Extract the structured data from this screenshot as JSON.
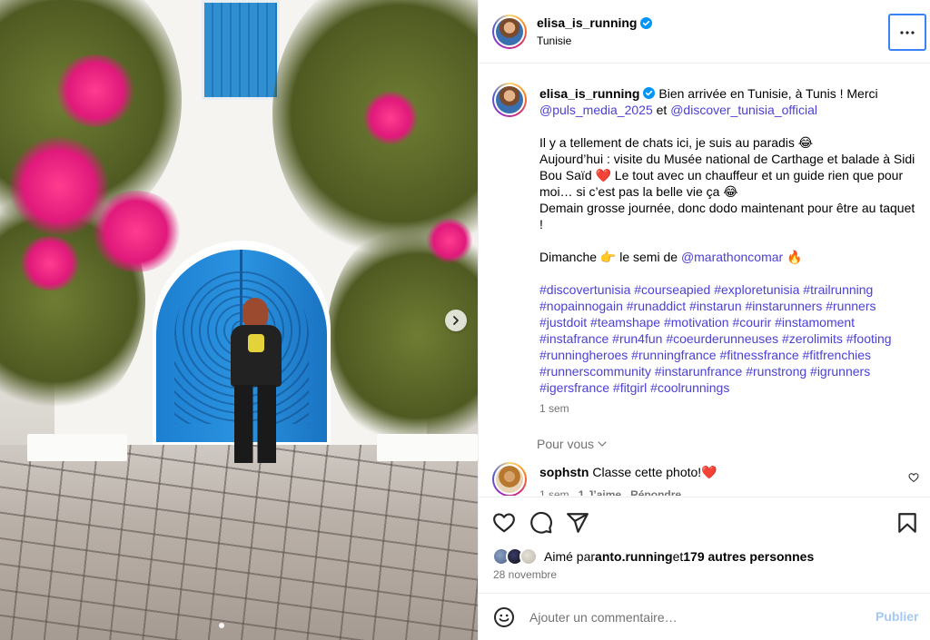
{
  "post": {
    "username": "elisa_is_running",
    "location": "Tunisie",
    "verified_icon": "verified-badge-icon",
    "more_icon": "more-options-icon"
  },
  "caption": {
    "username": "elisa_is_running",
    "intro": " Bien arrivée en Tunisie, à Tunis ! Merci ",
    "mention1": "@puls_media_2025",
    "and": " et ",
    "mention2": "@discover_tunisia_official",
    "line1": "Il y a tellement de chats ici, je suis au paradis 😂",
    "line2": "Aujourd’hui : visite du Musée national de Carthage et balade à Sidi Bou Saïd ❤️ Le tout avec un chauffeur et un guide rien que pour moi… si c’est pas la belle vie ça 😂",
    "line3": "Demain grosse journée, donc dodo maintenant pour être au taquet !",
    "sunday_prefix": "Dimanche 👉 le semi de ",
    "sunday_mention": "@marathoncomar",
    "sunday_suffix": " 🔥",
    "hashtags": "#discovertunisia #courseapied #exploretunisia #trailrunning #nopainnogain #runaddict #instarun #instarunners #runners #justdoit #teamshape #motivation #courir #instamoment #instafrance #run4fun #coeurderunneuses  #zerolimits #footing #runningheroes #runningfrance #fitnessfrance #fitfrenchies #runnerscommunity #instarunfrance #runstrong #igrunners #igersfrance #fitgirl #coolrunnings",
    "time_ago": "1 sem"
  },
  "translation": {
    "label": "Pour vous"
  },
  "comment": {
    "username": "sophstn",
    "text": " Classe cette photo!❤️",
    "time_ago": "1 sem",
    "likes": "1 J’aime",
    "reply": "Répondre"
  },
  "likes": {
    "prefix": "Aimé par ",
    "first_user": "anto.running",
    "middle": " et ",
    "others": "179 autres personnes",
    "date": "28 novembre"
  },
  "add_comment": {
    "placeholder": "Ajouter un commentaire…",
    "publish_label": "Publier"
  },
  "colors": {
    "link": "#4b3fd6",
    "muted": "#737373",
    "publish_disabled": "#a6c8f5",
    "focus_outline": "#3b82f6"
  },
  "icons": {
    "like": "heart-icon",
    "comment": "comment-icon",
    "share": "share-icon",
    "save": "bookmark-icon",
    "emoji": "emoji-icon",
    "next": "chevron-right-icon"
  }
}
